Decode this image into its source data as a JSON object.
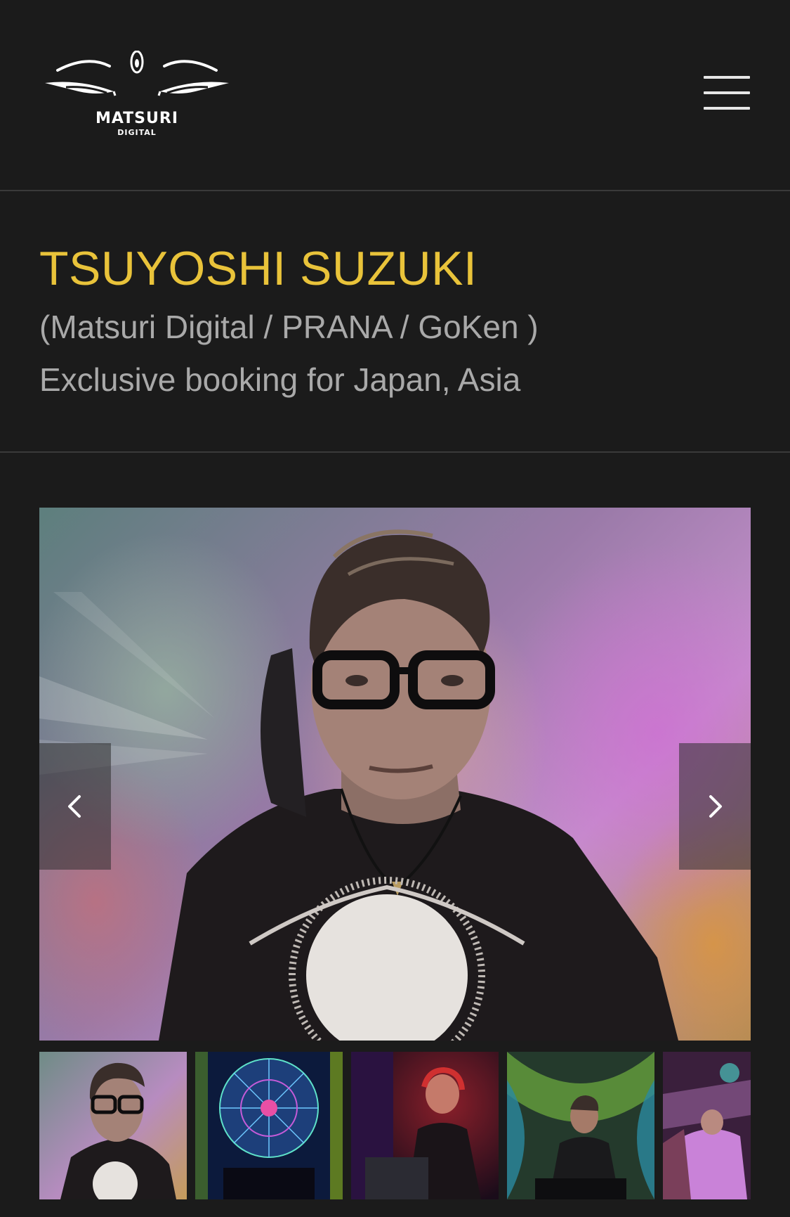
{
  "header": {
    "logo_text": "MATSURI",
    "logo_subtext": "DIGITAL",
    "menu_icon": "hamburger-menu-icon"
  },
  "artist": {
    "name": "TSUYOSHI SUZUKI",
    "labels": "(Matsuri Digital / PRANA / GoKen )",
    "booking": "Exclusive booking for Japan, Asia"
  },
  "gallery": {
    "prev_icon": "chevron-left-icon",
    "next_icon": "chevron-right-icon",
    "thumbnails": [
      "portrait-photo",
      "stage-dome-photo",
      "dj-red-light-photo",
      "dj-decks-photo",
      "crowd-photo"
    ]
  },
  "colors": {
    "background": "#1b1b1b",
    "accent": "#e9c33a",
    "secondary_text": "#a9a9a9",
    "divider": "#3a3a3a"
  }
}
